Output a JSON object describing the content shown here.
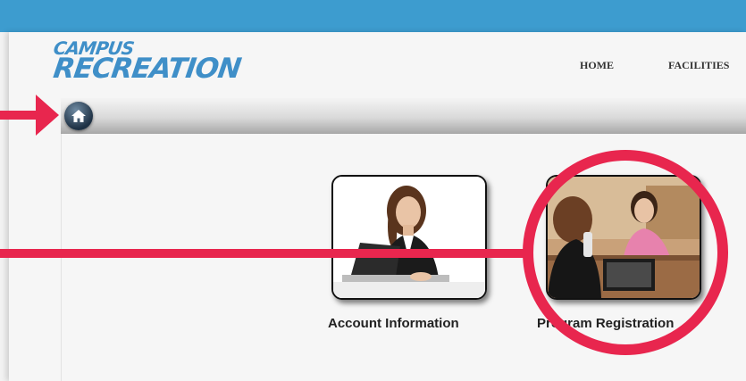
{
  "header": {
    "logo_line1": "CAMPUS",
    "logo_line2": "RECREATION",
    "nav": [
      {
        "label": "HOME"
      },
      {
        "label": "FACILITIES"
      }
    ]
  },
  "breadcrumb": {
    "home_icon": "home-icon"
  },
  "tiles": [
    {
      "label": "Account Information",
      "image": "woman-at-laptop-photo"
    },
    {
      "label": "Program Registration",
      "image": "registration-desk-photo"
    }
  ],
  "annotations": {
    "color": "#e8264e",
    "items": [
      "arrow pointing to home button",
      "line and circle highlighting Program Registration"
    ]
  },
  "colors": {
    "topbar": "#3d9ccf",
    "logo": "#3f8fc8"
  }
}
